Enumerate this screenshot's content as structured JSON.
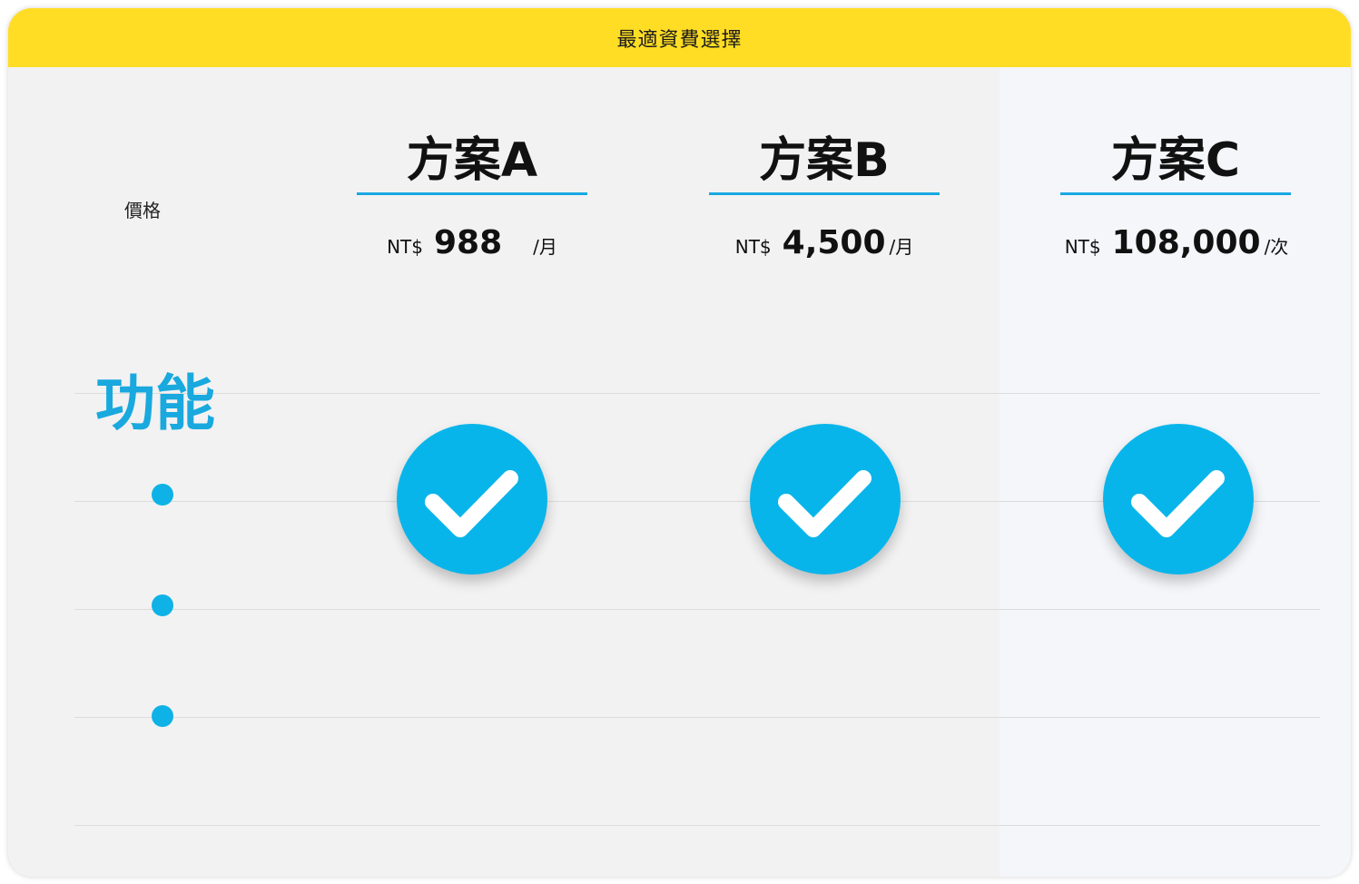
{
  "header": {
    "title": "最適資費選擇"
  },
  "price_label": "價格",
  "feature_label": "功能",
  "plans": [
    {
      "name": "方案A",
      "currency": "NT$",
      "amount": "988",
      "unit": "/月",
      "feature_checked": true
    },
    {
      "name": "方案B",
      "currency": "NT$",
      "amount": "4,500",
      "unit": "/月",
      "feature_checked": true
    },
    {
      "name": "方案C",
      "currency": "NT$",
      "amount": "108,000",
      "unit": "/次",
      "feature_checked": true
    }
  ],
  "feature_items_count": 3,
  "colors": {
    "header_bg": "#ffdd24",
    "accent": "#08b5ea",
    "card_bg": "#f2f2f2"
  },
  "icons": [
    "check-icon",
    "bullet-dot-icon"
  ]
}
